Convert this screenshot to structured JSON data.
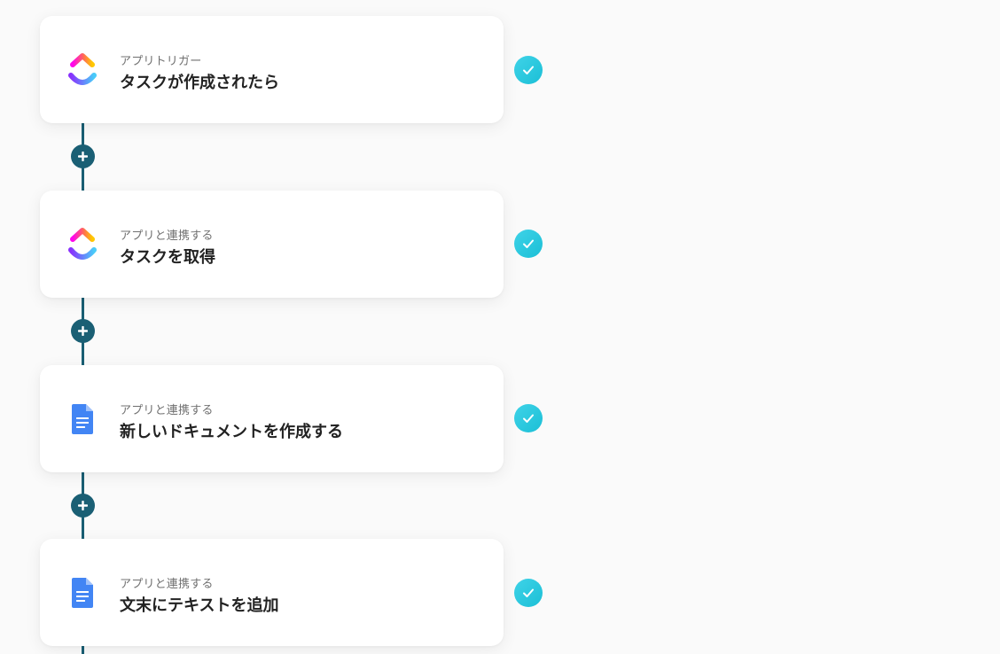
{
  "colors": {
    "connector": "#1a5f74",
    "check": "#1bbfd6",
    "card_bg": "#ffffff",
    "page_bg": "#fafafa"
  },
  "steps": [
    {
      "kind": "アプリトリガー",
      "title": "タスクが作成されたら",
      "app_icon": "clickup-icon",
      "status": "complete"
    },
    {
      "kind": "アプリと連携する",
      "title": "タスクを取得",
      "app_icon": "clickup-icon",
      "status": "complete"
    },
    {
      "kind": "アプリと連携する",
      "title": "新しいドキュメントを作成する",
      "app_icon": "google-docs-icon",
      "status": "complete"
    },
    {
      "kind": "アプリと連携する",
      "title": "文末にテキストを追加",
      "app_icon": "google-docs-icon",
      "status": "complete"
    }
  ],
  "add_step_icon": "plus-icon",
  "status_icon": "checkmark-icon"
}
